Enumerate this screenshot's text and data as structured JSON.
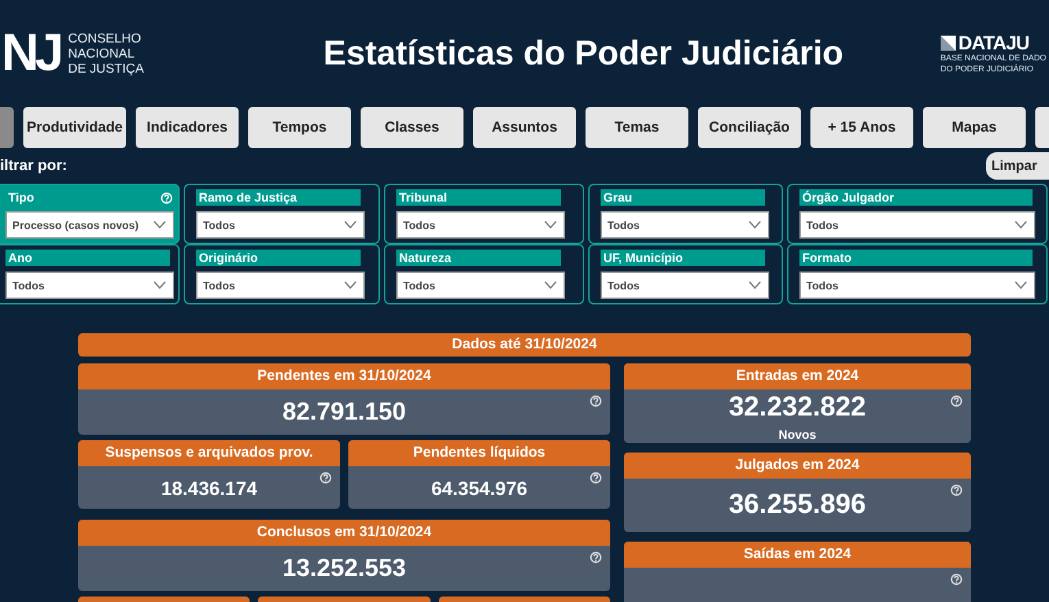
{
  "header": {
    "logo_text": "NJ",
    "org_name": [
      "CONSELHO",
      "NACIONAL",
      "DE JUSTIÇA"
    ],
    "title": "Estatísticas do Poder Judiciário",
    "brand": "DATAJU",
    "brand_subtitle": [
      "BASE NACIONAL DE DADO",
      "DO PODER JUDICIÁRIO"
    ]
  },
  "tabs": [
    {
      "label": "Produtividade",
      "selected": false
    },
    {
      "label": "Indicadores",
      "selected": false
    },
    {
      "label": "Tempos",
      "selected": false
    },
    {
      "label": "Classes",
      "selected": false
    },
    {
      "label": "Assuntos",
      "selected": false
    },
    {
      "label": "Temas",
      "selected": false
    },
    {
      "label": "Conciliação",
      "selected": false
    },
    {
      "label": "+ 15 Anos",
      "selected": false
    },
    {
      "label": "Mapas",
      "selected": false
    }
  ],
  "filters": {
    "label": "iltrar por:",
    "clear_button": "Limpar",
    "rows": [
      [
        {
          "label": "Tipo",
          "value": "Processo (casos novos)",
          "active": true,
          "help": true
        },
        {
          "label": "Ramo de Justiça",
          "value": "Todos",
          "active": false,
          "help": false
        },
        {
          "label": "Tribunal",
          "value": "Todos",
          "active": false,
          "help": false
        },
        {
          "label": "Grau",
          "value": "Todos",
          "active": false,
          "help": false
        },
        {
          "label": "Órgão Julgador",
          "value": "Todos",
          "active": false,
          "help": false
        }
      ],
      [
        {
          "label": "Ano",
          "value": "Todos",
          "active": false,
          "help": false
        },
        {
          "label": "Originário",
          "value": "Todos",
          "active": false,
          "help": false
        },
        {
          "label": "Natureza",
          "value": "Todos",
          "active": false,
          "help": false
        },
        {
          "label": "UF, Município",
          "value": "Todos",
          "active": false,
          "help": false
        },
        {
          "label": "Formato",
          "value": "Todos",
          "active": false,
          "help": false
        }
      ]
    ]
  },
  "summary": {
    "title": "Dados até 31/10/2024",
    "left_rows": [
      [
        {
          "kind": "big",
          "title": "Pendentes em 31/10/2024",
          "value": "82.791.150",
          "help": true
        }
      ],
      [
        {
          "kind": "small",
          "title": "Suspensos e arquivados prov.",
          "value": "18.436.174",
          "help": true
        },
        {
          "kind": "small",
          "title": "Pendentes líquidos",
          "value": "64.354.976",
          "help": true
        }
      ],
      [
        {
          "kind": "big",
          "title": "Conclusos em 31/10/2024",
          "value": "13.252.553",
          "help": true
        }
      ],
      [
        {
          "kind": "cut"
        },
        {
          "kind": "cut"
        },
        {
          "kind": "cut"
        }
      ]
    ],
    "right_cards": [
      {
        "kind": "big",
        "title": "Entradas em 2024",
        "value": "32.232.822",
        "note": "Novos",
        "help": true
      },
      {
        "kind": "big",
        "title": "Julgados em 2024",
        "value": "36.255.896",
        "help": true
      },
      {
        "kind": "open",
        "title": "Saídas em 2024",
        "help": true
      }
    ]
  }
}
